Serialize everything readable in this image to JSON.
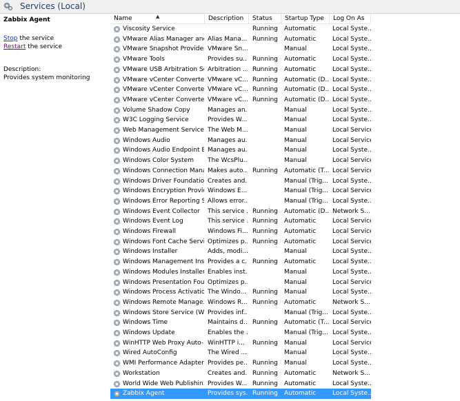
{
  "header": {
    "title": "Services (Local)"
  },
  "panel": {
    "service_name": "Zabbix Agent",
    "stop_link": "Stop",
    "stop_rest": " the service",
    "restart_link": "Restart",
    "restart_rest": " the service",
    "description_label": "Description:",
    "description_text": "Provides system monitoring"
  },
  "columns": [
    "Name",
    "Description",
    "Status",
    "Startup Type",
    "Log On As"
  ],
  "rows": [
    [
      "Viscosity Service",
      "",
      "Running",
      "Automatic",
      "Local Syste..."
    ],
    [
      "VMware Alias Manager and ...",
      "Alias Mana...",
      "Running",
      "Automatic",
      "Local Syste..."
    ],
    [
      "VMware Snapshot Provider",
      "VMware Sn...",
      "",
      "Manual",
      "Local Syste..."
    ],
    [
      "VMware Tools",
      "Provides su...",
      "Running",
      "Automatic",
      "Local Syste..."
    ],
    [
      "VMware USB Arbitration Ser...",
      "Arbitration ...",
      "Running",
      "Automatic",
      "Local Syste..."
    ],
    [
      "VMware vCenter Converter ...",
      "VMware vC...",
      "Running",
      "Automatic (D...",
      "Local Syste..."
    ],
    [
      "VMware vCenter Converter ...",
      "VMware vC...",
      "Running",
      "Automatic (D...",
      "Local Syste..."
    ],
    [
      "VMware vCenter Converter ...",
      "VMware vC...",
      "Running",
      "Automatic (D...",
      "Local Syste..."
    ],
    [
      "Volume Shadow Copy",
      "Manages an...",
      "",
      "Manual",
      "Local Syste..."
    ],
    [
      "W3C Logging Service",
      "Provides W...",
      "",
      "Manual",
      "Local Syste..."
    ],
    [
      "Web Management Service",
      "The Web M...",
      "",
      "Manual",
      "Local Service"
    ],
    [
      "Windows Audio",
      "Manages au...",
      "",
      "Manual",
      "Local Service"
    ],
    [
      "Windows Audio Endpoint B...",
      "Manages au...",
      "",
      "Manual",
      "Local Syste..."
    ],
    [
      "Windows Color System",
      "The WcsPlu...",
      "",
      "Manual",
      "Local Service"
    ],
    [
      "Windows Connection Mana...",
      "Makes auto...",
      "Running",
      "Automatic (T...",
      "Local Service"
    ],
    [
      "Windows Driver Foundation...",
      "Creates and...",
      "",
      "Manual (Trig...",
      "Local Syste..."
    ],
    [
      "Windows Encryption Provid...",
      "Windows E...",
      "",
      "Manual (Trig...",
      "Local Service"
    ],
    [
      "Windows Error Reporting Se...",
      "Allows error...",
      "",
      "Manual (Trig...",
      "Local Syste..."
    ],
    [
      "Windows Event Collector",
      "This service ...",
      "Running",
      "Automatic (D...",
      "Network S..."
    ],
    [
      "Windows Event Log",
      "This service ...",
      "Running",
      "Automatic",
      "Local Service"
    ],
    [
      "Windows Firewall",
      "Windows Fi...",
      "Running",
      "Automatic",
      "Local Service"
    ],
    [
      "Windows Font Cache Service",
      "Optimizes p...",
      "Running",
      "Automatic",
      "Local Service"
    ],
    [
      "Windows Installer",
      "Adds, modi...",
      "",
      "Manual",
      "Local Syste..."
    ],
    [
      "Windows Management Inst...",
      "Provides a c...",
      "Running",
      "Automatic",
      "Local Syste..."
    ],
    [
      "Windows Modules Installer",
      "Enables inst...",
      "",
      "Manual",
      "Local Syste..."
    ],
    [
      "Windows Presentation Fou...",
      "Optimizes p...",
      "",
      "Manual",
      "Local Service"
    ],
    [
      "Windows Process Activatio...",
      "The Windo...",
      "Running",
      "Manual",
      "Local Syste..."
    ],
    [
      "Windows Remote Manage...",
      "Windows R...",
      "Running",
      "Automatic",
      "Network S..."
    ],
    [
      "Windows Store Service (WS...",
      "Provides inf...",
      "",
      "Manual (Trig...",
      "Local Syste..."
    ],
    [
      "Windows Time",
      "Maintains d...",
      "Running",
      "Automatic (T...",
      "Local Service"
    ],
    [
      "Windows Update",
      "Enables the ...",
      "",
      "Manual (Trig...",
      "Local Syste..."
    ],
    [
      "WinHTTP Web Proxy Auto-...",
      "WinHTTP i...",
      "Running",
      "Manual",
      "Local Service"
    ],
    [
      "Wired AutoConfig",
      "The Wired ...",
      "",
      "Manual",
      "Local Syste..."
    ],
    [
      "WMI Performance Adapter",
      "Provides pe...",
      "Running",
      "Manual",
      "Local Syste..."
    ],
    [
      "Workstation",
      "Creates and...",
      "Running",
      "Automatic",
      "Network S..."
    ],
    [
      "World Wide Web Publishin...",
      "Provides W...",
      "Running",
      "Automatic",
      "Local Syste..."
    ],
    [
      "Zabbix Agent",
      "Provides sys...",
      "Running",
      "Automatic",
      "Local Syste..."
    ]
  ],
  "selected_index": 36,
  "colors": {
    "selection": "#3399ff",
    "link": "#0a30c8",
    "visited": "#800080"
  }
}
